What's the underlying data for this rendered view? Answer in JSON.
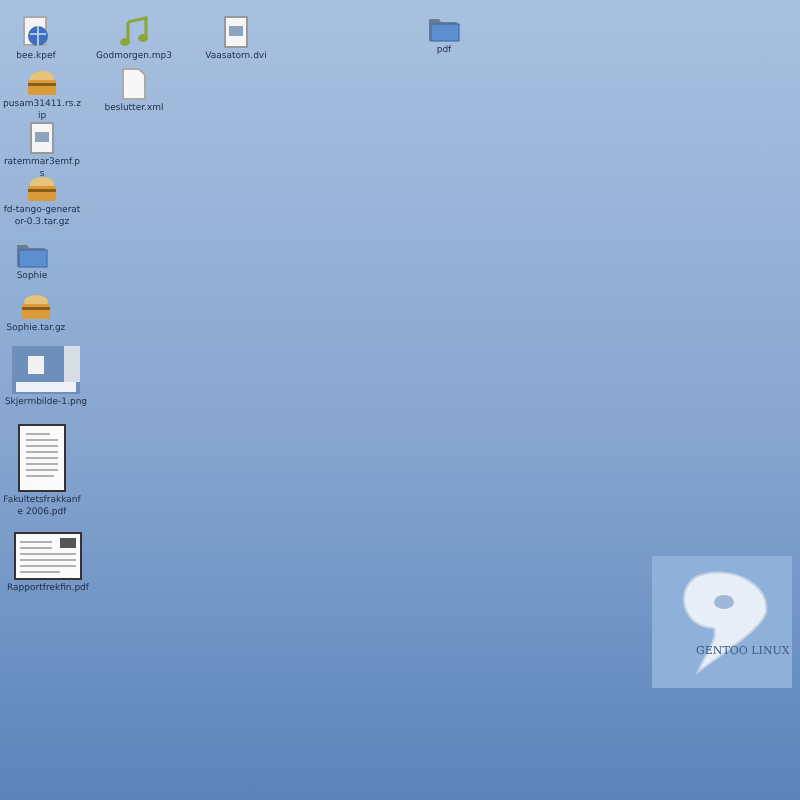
{
  "desktop_icons": [
    {
      "kind": "web",
      "label": "bee.kpef"
    },
    {
      "kind": "audio",
      "label": "Godmorgen.mp3"
    },
    {
      "kind": "image",
      "label": "Vaasatorn.dvi"
    },
    {
      "kind": "folder",
      "label": "pdf"
    },
    {
      "kind": "archive",
      "label": "pusam31411.rs.zip"
    },
    {
      "kind": "document",
      "label": "beslutter.xml"
    },
    {
      "kind": "image",
      "label": "ratemmar3emf.ps"
    },
    {
      "kind": "archive",
      "label": "fd-tango-generator-0.3.tar.gz"
    },
    {
      "kind": "folder",
      "label": "Sophie"
    },
    {
      "kind": "archive",
      "label": "Sophie.tar.gz"
    },
    {
      "kind": "screenshot",
      "label": "Skjermbilde-1.png"
    },
    {
      "kind": "pdf-portrait",
      "label": "Fakultetsfrakkanfe 2006.pdf"
    },
    {
      "kind": "pdf-landscape",
      "label": "Rapportfrekfin.pdf"
    }
  ],
  "logo": {
    "text": "GENTOO LINUX"
  }
}
